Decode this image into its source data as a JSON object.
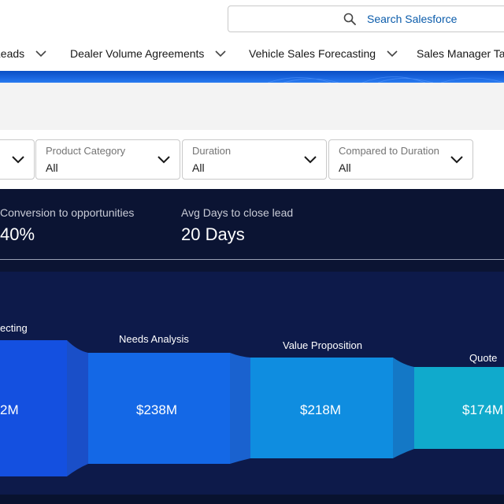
{
  "header": {
    "search_placeholder": "Search Salesforce",
    "search_icon": "search-icon"
  },
  "nav": {
    "items": [
      {
        "label": "Leads"
      },
      {
        "label": "Dealer Volume Agreements"
      },
      {
        "label": "Vehicle Sales Forecasting"
      },
      {
        "label": "Sales Manager Tar"
      }
    ]
  },
  "filters": [
    {
      "label": "",
      "value": ""
    },
    {
      "label": "Product Category",
      "value": "All"
    },
    {
      "label": "Duration",
      "value": "All"
    },
    {
      "label": "Compared to Duration",
      "value": "All"
    }
  ],
  "kpis": [
    {
      "label": "Conversion to opportunities",
      "value": "40%"
    },
    {
      "label": "Avg Days to close lead",
      "value": "20 Days"
    }
  ],
  "funnel": {
    "stages": [
      {
        "label": "ecting",
        "value": "2M",
        "color": "#1450e0"
      },
      {
        "label": "Needs  Analysis",
        "value": "$238M",
        "color": "#1468e6"
      },
      {
        "label": "Value Proposition",
        "value": "$218M",
        "color": "#0f8de0"
      },
      {
        "label": "Quote",
        "value": "$174M",
        "color": "#10aacc"
      }
    ]
  },
  "colors": {
    "brand_band": "#1a66e0",
    "kpi_background": "#0b1433",
    "funnel_background": "#0d1a4a",
    "search_text": "#0b5cab"
  }
}
